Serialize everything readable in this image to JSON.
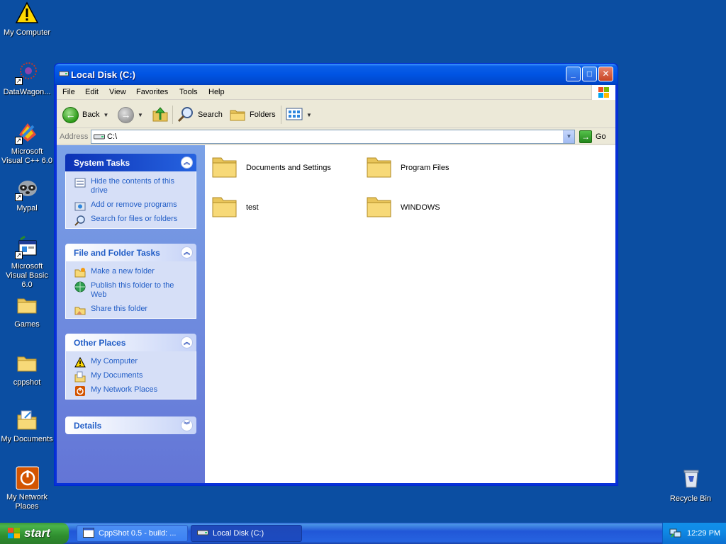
{
  "desktop": {
    "icons": [
      {
        "label": "My Computer"
      },
      {
        "label": "DataWagon..."
      },
      {
        "label": "Microsoft Visual C++ 6.0"
      },
      {
        "label": "Mypal"
      },
      {
        "label": "Microsoft Visual Basic 6.0"
      },
      {
        "label": "Games"
      },
      {
        "label": "cppshot"
      },
      {
        "label": "My Documents"
      },
      {
        "label": "My Network Places"
      },
      {
        "label": "Recycle Bin"
      }
    ]
  },
  "window": {
    "title": "Local Disk (C:)",
    "controls": {
      "minimize": "_",
      "maximize": "□",
      "close": "✕"
    },
    "menu": [
      "File",
      "Edit",
      "View",
      "Favorites",
      "Tools",
      "Help"
    ],
    "toolbar": {
      "back": "Back",
      "search": "Search",
      "folders": "Folders"
    },
    "address": {
      "label": "Address",
      "value": "C:\\",
      "go": "Go"
    },
    "taskpane": {
      "system_tasks": {
        "title": "System Tasks",
        "items": [
          "Hide the contents of this drive",
          "Add or remove programs",
          "Search for files or folders"
        ]
      },
      "file_folder_tasks": {
        "title": "File and Folder Tasks",
        "items": [
          "Make a new folder",
          "Publish this folder to the Web",
          "Share this folder"
        ]
      },
      "other_places": {
        "title": "Other Places",
        "items": [
          "My Computer",
          "My Documents",
          "My Network Places"
        ]
      },
      "details": {
        "title": "Details"
      }
    },
    "files": [
      "Documents and Settings",
      "Program Files",
      "test",
      "WINDOWS"
    ]
  },
  "taskbar": {
    "start": "start",
    "buttons": [
      "CppShot 0.5 - build: ...",
      "Local Disk (C:)"
    ],
    "clock": "12:29 PM"
  },
  "colors": {
    "desktop": "#0b4ea2",
    "link": "#215dc6",
    "title_blue": "#0054e3",
    "start_green": "#3c9a3c"
  }
}
